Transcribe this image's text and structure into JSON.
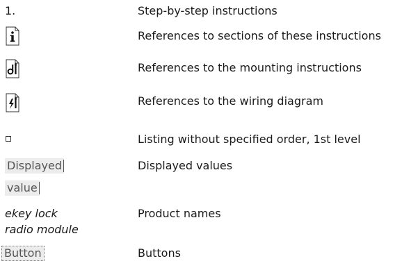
{
  "legend": {
    "step": {
      "symbol": "1.",
      "description": "Step-by-step instructions"
    },
    "section_ref": {
      "icon": "info-document-icon",
      "description": "References to sections of these instructions"
    },
    "mounting_ref": {
      "icon": "mounting-tools-icon",
      "description": "References to the mounting instructions"
    },
    "wiring_ref": {
      "icon": "wiring-lightning-icon",
      "description": "References to the wiring diagram"
    },
    "listing": {
      "icon": "square-bullet-icon",
      "description": "Listing without specified order, 1st level"
    },
    "displayed": {
      "sample_line1": "Displayed",
      "sample_line2": "value",
      "description": "Displayed values"
    },
    "product": {
      "sample_line1": "ekey lock",
      "sample_line2": "radio module",
      "description": "Product names"
    },
    "button": {
      "sample": "Button",
      "description": "Buttons"
    }
  }
}
